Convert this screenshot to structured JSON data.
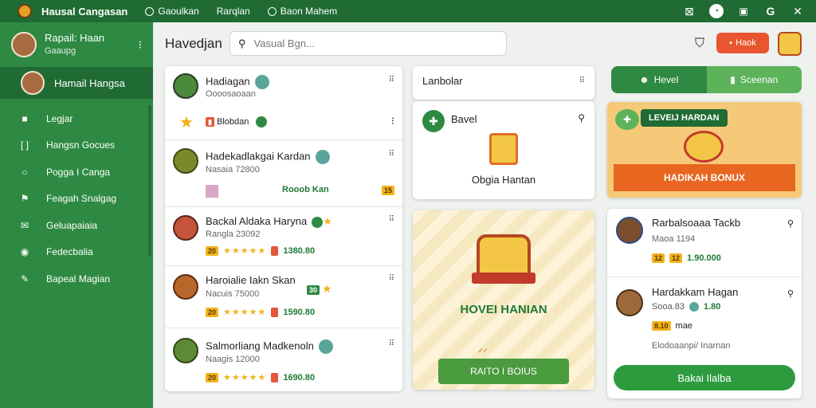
{
  "topbar": {
    "app_title": "Hausal Cangasan",
    "nav": [
      "Gaoulkan",
      "Rarqlan",
      "Baon Mahem"
    ],
    "icons": [
      "logo-icon",
      "window-icon",
      "clock-icon",
      "save-icon",
      "google-icon",
      "close-icon"
    ]
  },
  "sidebar": {
    "profile_name": "Rapail: Haan",
    "profile_sub": "Gaaupg",
    "active_item": "Hamail Hangsa",
    "menu": [
      {
        "label": "Legjar",
        "icon": "square-icon"
      },
      {
        "label": "Hangsn Gocues",
        "icon": "bracket-icon"
      },
      {
        "label": "Pogga I Canga",
        "icon": "circle-icon"
      },
      {
        "label": "Feagah Snalgag",
        "icon": "flag-icon"
      },
      {
        "label": "Geluapaiaia",
        "icon": "mail-icon"
      },
      {
        "label": "Fedecbalia",
        "icon": "dot-icon"
      },
      {
        "label": "Bapeal Magian",
        "icon": "pen-icon"
      }
    ]
  },
  "header": {
    "title": "Havedjan",
    "search_placeholder": "Vasual Bgn...",
    "button_label": "Haok"
  },
  "list": [
    {
      "title": "Hadiagan",
      "sub": "Oooosaoaan",
      "ctrl": "⠿",
      "extra_label": "Blobdan"
    },
    {
      "title": "Hadekadlakgai Kardan",
      "sub": "Nasaia 72800",
      "ctrl": "⠿",
      "extra_label": "Rooob Kan",
      "extra_value": "15"
    },
    {
      "title": "Backal Aldaka Haryna",
      "sub": "Rangla 23092",
      "ctrl": "⠿",
      "tag": "20",
      "price": "1380.80"
    },
    {
      "title": "Haroialie Iakn Skan",
      "sub": "Nacuis 75000",
      "ctrl": "⠿",
      "tag": "20",
      "price": "1590.80",
      "badge": "30"
    },
    {
      "title": "Salmorliang Madkenoln",
      "sub": "Naagis 12000",
      "ctrl": "⠿",
      "tag": "20",
      "price": "1690.80"
    }
  ],
  "middle": {
    "head_title": "Lanbolar",
    "action_title": "Bavel",
    "action_caption": "Obgia Hantan",
    "promo_title": "HOVEI HANIAN",
    "promo_button": "RAITO I BOIUS"
  },
  "right": {
    "seg_left": "Hevel",
    "seg_right": "Sceenan",
    "bonus_pill": "LEVEIJ HARDAN",
    "bonus_banner": "HADIKAH BONUX",
    "users": [
      {
        "name": "Rarbalsoaaa Tackb",
        "sub": "Maoa 1194",
        "tag": "12",
        "tag2": "12",
        "price": "1.90.000"
      },
      {
        "name": "Hardakkam Hagan",
        "sub": "Sooa.83",
        "price_green": "1.80",
        "tag": "8.10",
        "note_tail": "mae",
        "desc": "Elodoaanpi/ Inarnan"
      }
    ],
    "cta": "Bakai Ilalba"
  },
  "colors": {
    "primary": "#2e8a42",
    "primary_dark": "#1f6b33",
    "accent": "#e9552f",
    "gold": "#f2b21c"
  }
}
